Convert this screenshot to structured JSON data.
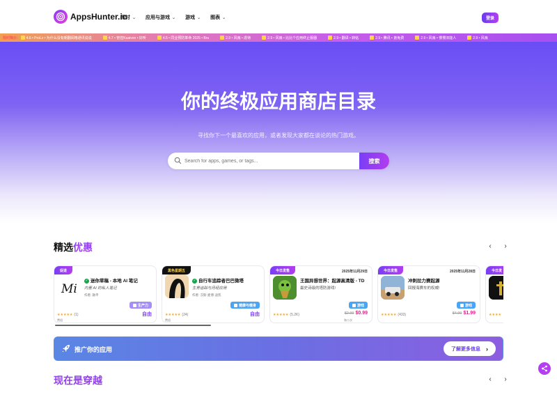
{
  "header": {
    "logo_text": "AppsHunter.io",
    "nav": [
      {
        "label": "探讨"
      },
      {
        "label": "应用与游戏"
      },
      {
        "label": "游戏"
      },
      {
        "label": "图表"
      }
    ],
    "login_label": "登录"
  },
  "ticker": {
    "label": "限时降价:",
    "items": [
      "4.6 • ProLz • 为什么没有朝翻阅格通讯说说",
      "4.7 • 管控Kuaivon • 好听",
      "4.5 • 同业预防革命 2025 • Bru",
      "2.9 • 风扇 • 虐待",
      "2.9 • 风扇 • 比比个应用终止服器",
      "2.9 • 翻译 • 转帖",
      "2.9 • 腾讯 • 弟免费",
      "2.9 • 风扇 • 慢慢旧能人",
      "2.9 • 风扇"
    ]
  },
  "hero": {
    "title": "你的终极应用商店目录",
    "subtitle": "寻找你下一个最喜欢的应用，或者发现大家都在谈论的热门游戏。",
    "search_placeholder": "Search for apps, games, or tags...",
    "search_button": "搜索"
  },
  "featured": {
    "title_main": "精选",
    "title_highlight": "优惠",
    "prev": "‹",
    "next": "›",
    "cards": [
      {
        "badge": "促进",
        "name": "迷你草稿 - 本地 AI 笔记",
        "tagline": "内置 AI 的私人笔记",
        "author": "作者: 融平",
        "category": "生产力",
        "rating": "★★★★★",
        "count": "(1)",
        "price": "自由",
        "sub": "费组"
      },
      {
        "badge": "黑色星期五",
        "name": "自行车追踪者巴巴微塔",
        "tagline": "生育追踪与月经应用",
        "author": "作者: 汉斯-麦博·迪凯",
        "category": "健康与健身",
        "rating": "★★★★★",
        "count": "(24)",
        "price": "自由",
        "sub": "费组"
      },
      {
        "badge": "今日发售",
        "date": "2025年11月29日",
        "name": "王国异想世界：起源高清版 - TD",
        "tagline": "最史诗级的塔防游戏!",
        "author": "",
        "category": "游戏",
        "rating": "★★★★★",
        "count": "(5.2K)",
        "old_price": "$2.99",
        "price": "$0.99",
        "sub": "和二次"
      },
      {
        "badge": "今日发售",
        "date": "2025年11月28日",
        "name": "冲刺拉力赛起源",
        "tagline": "回报海赛车的权威!",
        "author": "",
        "category": "游戏",
        "rating": "★★★★★",
        "count": "(433)",
        "old_price": "$4.99",
        "price": "$1.99",
        "sub": ""
      },
      {
        "badge": "今日发",
        "name": "",
        "tagline": "",
        "author": "",
        "category": "",
        "rating": "★★★★",
        "count": "",
        "price": "",
        "sub": ""
      }
    ]
  },
  "promo": {
    "text": "推广你的应用",
    "button": "了解更多信息"
  },
  "trending": {
    "title_main": "现在是",
    "title_highlight": "穿越",
    "prev": "‹",
    "next": "›"
  },
  "colors": {
    "accent": "#7a3ef4",
    "accent2": "#b23df0",
    "price_sale": "#e0248a",
    "verified": "#16a34a",
    "stars": "#f5a623"
  }
}
